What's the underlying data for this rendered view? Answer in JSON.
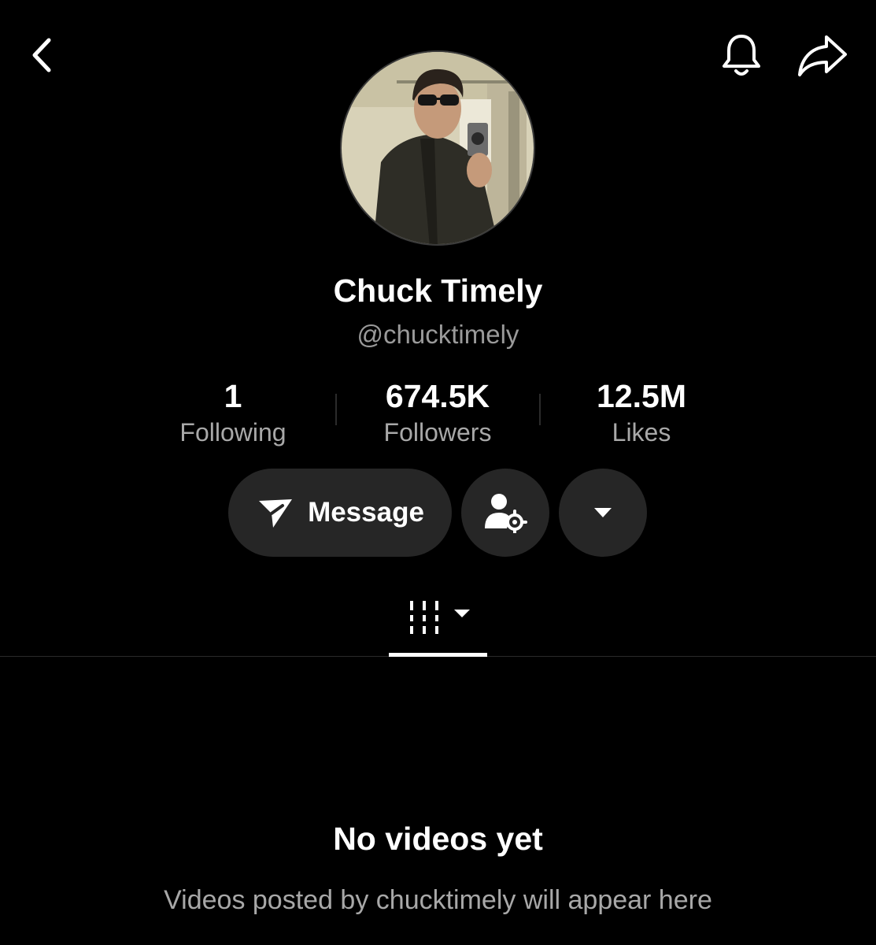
{
  "header": {
    "back_icon": "chevron-left-icon",
    "bell_icon": "bell-icon",
    "share_icon": "share-arrow-icon"
  },
  "profile": {
    "display_name": "Chuck Timely",
    "handle": "@chucktimely"
  },
  "stats": [
    {
      "value": "1",
      "label": "Following"
    },
    {
      "value": "674.5K",
      "label": "Followers"
    },
    {
      "value": "12.5M",
      "label": "Likes"
    }
  ],
  "actions": {
    "message_label": "Message",
    "message_icon": "paper-plane-icon",
    "profile_settings_icon": "user-gear-icon",
    "more_icon": "caret-down-icon"
  },
  "tabs": {
    "videos_icon": "grid-columns-icon",
    "videos_dropdown_icon": "caret-down-icon"
  },
  "empty_state": {
    "title": "No videos yet",
    "subtitle": "Videos posted by chucktimely will appear here"
  },
  "colors": {
    "background": "#000000",
    "pill": "#262626",
    "muted_text": "#a8a8a8"
  }
}
